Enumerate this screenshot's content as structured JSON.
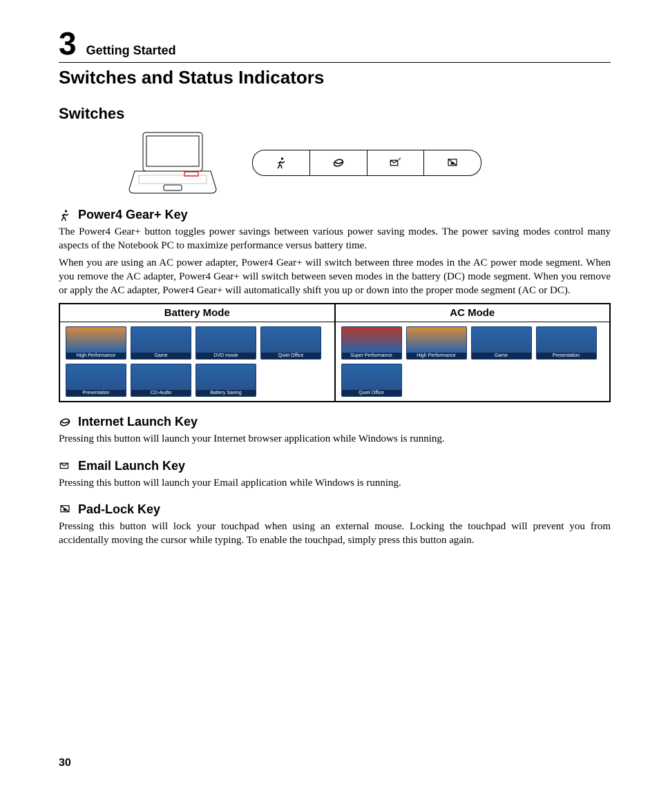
{
  "chapter": {
    "num": "3",
    "label": "Getting Started"
  },
  "title": "Switches and Status Indicators",
  "section_switches": "Switches",
  "panel_icons": [
    "running",
    "globe",
    "email",
    "padlock"
  ],
  "sections": {
    "power4": {
      "heading": "Power4 Gear+ Key",
      "p1": "The Power4 Gear+ button toggles power savings between various power saving modes. The power saving modes control many aspects of the Notebook PC to maximize performance versus battery time.",
      "p2": "When you are using an AC power adapter, Power4 Gear+ will switch between three modes in the AC power mode segment. When you remove the AC adapter, Power4 Gear+ will switch between seven modes in the battery (DC) mode segment. When you remove or apply the AC adapter, Power4 Gear+ will automatically shift you up or down into the proper mode segment (AC or DC)."
    },
    "internet": {
      "heading": "Internet Launch Key",
      "p": "Pressing this button will launch your Internet browser application while Windows is running."
    },
    "email": {
      "heading": "Email Launch Key",
      "p": "Pressing this button will launch your Email application while Windows is running."
    },
    "padlock": {
      "heading": "Pad-Lock Key",
      "p": "Pressing this button will lock your touchpad when using an external mouse. Locking the touchpad will prevent you from accidentally moving the cursor while typing. To enable the touchpad, simply press this button again."
    }
  },
  "table": {
    "hdr_battery": "Battery Mode",
    "hdr_ac": "AC Mode",
    "battery": [
      {
        "label": "High Performance",
        "cls": "orange"
      },
      {
        "label": "Game",
        "cls": ""
      },
      {
        "label": "DVD movie",
        "cls": ""
      },
      {
        "label": "Quiet Office",
        "cls": ""
      },
      {
        "label": "Presentation",
        "cls": ""
      },
      {
        "label": "CD-Audio",
        "cls": ""
      },
      {
        "label": "Battery Saving",
        "cls": ""
      }
    ],
    "ac": [
      {
        "label": "Super Performance",
        "cls": "red"
      },
      {
        "label": "High Performance",
        "cls": "orange"
      },
      {
        "label": "Game",
        "cls": ""
      },
      {
        "label": "Presentation",
        "cls": ""
      },
      {
        "label": "Quiet Office",
        "cls": ""
      }
    ]
  },
  "page_number": "30"
}
